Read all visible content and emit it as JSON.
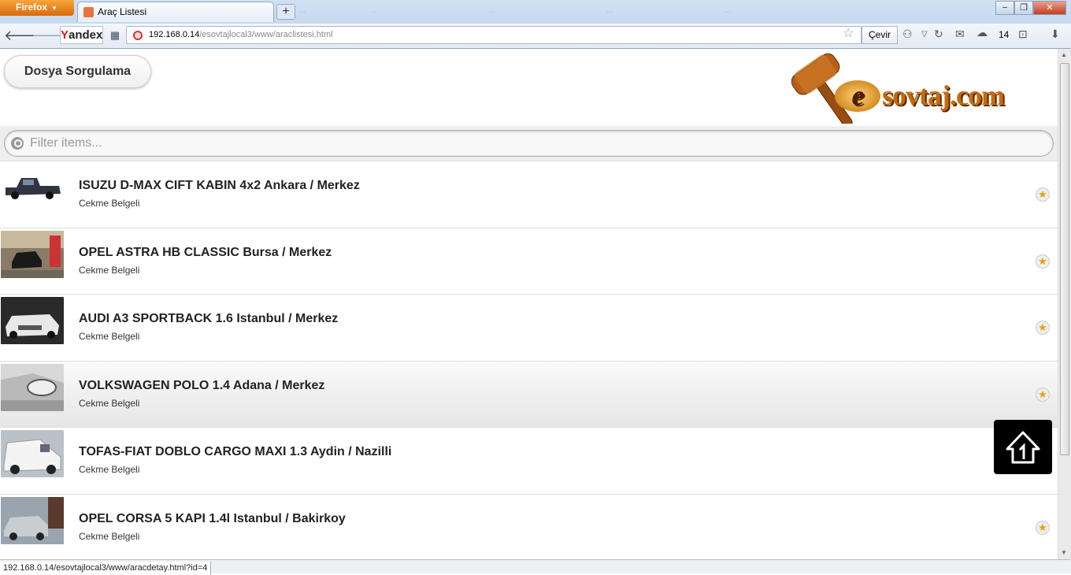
{
  "browser": {
    "menu_button": "Firefox",
    "tab_title": "Araç Listesi",
    "new_tab": "+",
    "background_tabs": [
      "...",
      "...",
      "...",
      "...",
      "..."
    ],
    "window_controls": [
      "−",
      "❐",
      "✕"
    ],
    "yandex": {
      "first": "Y",
      "rest": "andex"
    },
    "url_host": "192.168.0.14",
    "url_path": "/esovtajlocal3/www/araclistesi.html",
    "translate_button": "Çevir",
    "weather_temp": "14",
    "status_url": "192.168.0.14/esovtajlocal3/www/aracdetay.html?id=4"
  },
  "page": {
    "query_button": "Dosya Sorgulama",
    "logo": {
      "e": "e",
      "text": "sovtaj.com"
    },
    "filter_placeholder": "Filter items...",
    "vehicles": [
      {
        "title": "ISUZU D-MAX CIFT KABIN 4x2 Ankara / Merkez",
        "subtitle": "Cekme Belgeli"
      },
      {
        "title": "OPEL ASTRA HB CLASSIC Bursa / Merkez",
        "subtitle": "Cekme Belgeli"
      },
      {
        "title": "AUDI A3 SPORTBACK 1.6 Istanbul / Merkez",
        "subtitle": "Cekme Belgeli"
      },
      {
        "title": "VOLKSWAGEN POLO 1.4 Adana / Merkez",
        "subtitle": "Cekme Belgeli"
      },
      {
        "title": "TOFAS-FIAT DOBLO CARGO MAXI 1.3 Aydin / Nazilli",
        "subtitle": "Cekme Belgeli"
      },
      {
        "title": "OPEL CORSA 5 KAPI 1.4l Istanbul / Bakirkoy",
        "subtitle": "Cekme Belgeli"
      }
    ]
  },
  "colors": {
    "accent_orange": "#c56a0e",
    "star": "#e3a400"
  }
}
